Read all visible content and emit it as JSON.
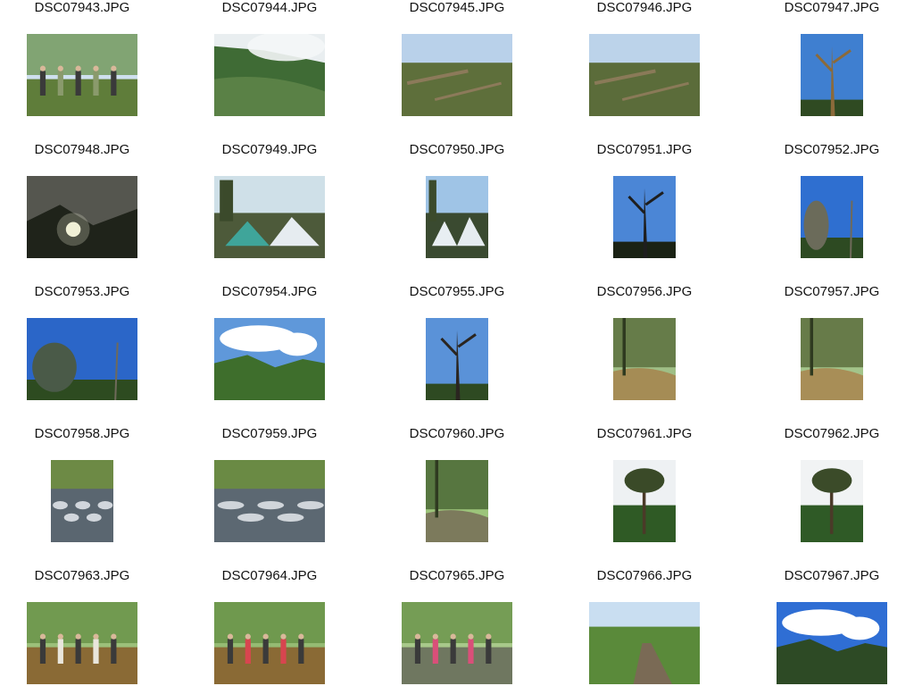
{
  "thumbnails": [
    {
      "name": "DSC07943.JPG",
      "orientation": "landscape",
      "scene": "hillside-hikers",
      "colors": {
        "sky": "#cfe0ef",
        "ground": "#5f7d3a",
        "accent": "#8a9a6c"
      }
    },
    {
      "name": "DSC07944.JPG",
      "orientation": "landscape",
      "scene": "misty-mountain",
      "colors": {
        "sky": "#e9eef0",
        "ground": "#3f6b35",
        "accent": "#6c8f52"
      }
    },
    {
      "name": "DSC07945.JPG",
      "orientation": "landscape",
      "scene": "fallen-trees",
      "colors": {
        "sky": "#b9d1ea",
        "ground": "#5e6f3b",
        "accent": "#8c7a5a"
      }
    },
    {
      "name": "DSC07946.JPG",
      "orientation": "landscape",
      "scene": "fallen-trees",
      "colors": {
        "sky": "#bcd3ea",
        "ground": "#5b6c3a",
        "accent": "#8a7a58"
      }
    },
    {
      "name": "DSC07947.JPG",
      "orientation": "portrait",
      "scene": "lone-tree",
      "colors": {
        "sky": "#3f7fd0",
        "ground": "#2f4a22",
        "accent": "#8b6a3a"
      }
    },
    {
      "name": "DSC07948.JPG",
      "orientation": "landscape",
      "scene": "dusk-sun",
      "colors": {
        "sky": "#55564f",
        "ground": "#1f231a",
        "accent": "#f1f0d6"
      }
    },
    {
      "name": "DSC07949.JPG",
      "orientation": "landscape",
      "scene": "camp-tents",
      "colors": {
        "sky": "#cfe0e8",
        "ground": "#4d5a3a",
        "accent": "#3fa59a"
      }
    },
    {
      "name": "DSC07950.JPG",
      "orientation": "portrait",
      "scene": "camp-tents",
      "colors": {
        "sky": "#9fc4e6",
        "ground": "#3a4a30",
        "accent": "#e8eef2"
      }
    },
    {
      "name": "DSC07951.JPG",
      "orientation": "portrait",
      "scene": "dead-tree",
      "colors": {
        "sky": "#4b86d6",
        "ground": "#1a2214",
        "accent": "#1e1e1e"
      }
    },
    {
      "name": "DSC07952.JPG",
      "orientation": "portrait",
      "scene": "tree-sky",
      "colors": {
        "sky": "#2f6fd0",
        "ground": "#2d4a22",
        "accent": "#6b6b5a"
      }
    },
    {
      "name": "DSC07953.JPG",
      "orientation": "landscape",
      "scene": "tree-sky",
      "colors": {
        "sky": "#2b66c8",
        "ground": "#2d4b20",
        "accent": "#4a5a48"
      }
    },
    {
      "name": "DSC07954.JPG",
      "orientation": "landscape",
      "scene": "clouds-valley",
      "colors": {
        "sky": "#5f98da",
        "ground": "#3e6e2c",
        "accent": "#ffffff"
      }
    },
    {
      "name": "DSC07955.JPG",
      "orientation": "portrait",
      "scene": "dead-tree",
      "colors": {
        "sky": "#5a92d8",
        "ground": "#2e4a22",
        "accent": "#2a2520"
      }
    },
    {
      "name": "DSC07956.JPG",
      "orientation": "portrait",
      "scene": "forest-stream",
      "colors": {
        "sky": "#9fbf86",
        "ground": "#4f5f2f",
        "accent": "#a58c55"
      }
    },
    {
      "name": "DSC07957.JPG",
      "orientation": "portrait",
      "scene": "forest-stream",
      "colors": {
        "sky": "#a3c48a",
        "ground": "#4d5d2e",
        "accent": "#a88e57"
      }
    },
    {
      "name": "DSC07958.JPG",
      "orientation": "portrait",
      "scene": "rapids",
      "colors": {
        "sky": "#6d8a45",
        "ground": "#5a6670",
        "accent": "#e6eaee"
      }
    },
    {
      "name": "DSC07959.JPG",
      "orientation": "landscape",
      "scene": "rapids",
      "colors": {
        "sky": "#6a8a44",
        "ground": "#5c6872",
        "accent": "#e4e9ec"
      }
    },
    {
      "name": "DSC07960.JPG",
      "orientation": "portrait",
      "scene": "forest-creek",
      "colors": {
        "sky": "#9cc47a",
        "ground": "#3b5528",
        "accent": "#7c7a5c"
      }
    },
    {
      "name": "DSC07961.JPG",
      "orientation": "portrait",
      "scene": "big-tree",
      "colors": {
        "sky": "#eef1f3",
        "ground": "#2f5a25",
        "accent": "#3a4a28"
      }
    },
    {
      "name": "DSC07962.JPG",
      "orientation": "portrait",
      "scene": "big-tree",
      "colors": {
        "sky": "#f1f3f4",
        "ground": "#2f5a26",
        "accent": "#3b4b29"
      }
    },
    {
      "name": "DSC07963.JPG",
      "orientation": "landscape",
      "scene": "hikers-stream",
      "colors": {
        "sky": "#9cc07a",
        "ground": "#8a6a35",
        "accent": "#e9e6dc"
      }
    },
    {
      "name": "DSC07964.JPG",
      "orientation": "landscape",
      "scene": "hikers-stream",
      "colors": {
        "sky": "#95bb73",
        "ground": "#8a6a35",
        "accent": "#d8454f"
      }
    },
    {
      "name": "DSC07965.JPG",
      "orientation": "landscape",
      "scene": "group-hikers",
      "colors": {
        "sky": "#a8c98a",
        "ground": "#6f7760",
        "accent": "#d94f79"
      }
    },
    {
      "name": "DSC07966.JPG",
      "orientation": "landscape",
      "scene": "forest-path",
      "colors": {
        "sky": "#c9def1",
        "ground": "#5a8a3a",
        "accent": "#7a6a55"
      }
    },
    {
      "name": "DSC07967.JPG",
      "orientation": "landscape",
      "scene": "mountains-clouds",
      "colors": {
        "sky": "#2f6ed4",
        "ground": "#2d4a25",
        "accent": "#ffffff"
      }
    }
  ]
}
